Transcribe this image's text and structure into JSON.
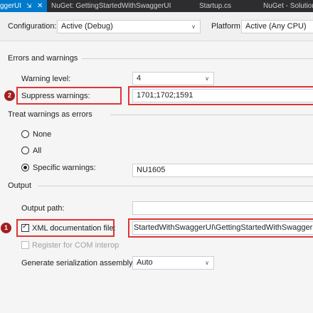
{
  "tabs": [
    {
      "label": "ggerUI",
      "active": true
    },
    {
      "label": "NuGet: GettingStartedWithSwaggerUI",
      "active": false
    },
    {
      "label": "Startup.cs",
      "active": false
    },
    {
      "label": "NuGet - Solution",
      "active": false
    }
  ],
  "tab_icons": {
    "pin": "pin-icon",
    "close": "close-icon"
  },
  "config_bar": {
    "configuration_label": "Configuration:",
    "configuration_value": "Active (Debug)",
    "platform_label": "Platform:",
    "platform_value": "Active (Any CPU)"
  },
  "errors_section": {
    "title": "Errors and warnings",
    "warning_level_label": "Warning level:",
    "warning_level_value": "4",
    "suppress_label": "Suppress warnings:",
    "suppress_value": "1701;1702;1591"
  },
  "treat_warnings": {
    "title": "Treat warnings as errors",
    "none_label": "None",
    "all_label": "All",
    "specific_label": "Specific warnings:",
    "specific_value": "NU1605",
    "selected": "specific"
  },
  "output": {
    "title": "Output",
    "output_path_label": "Output path:",
    "output_path_value": "",
    "xml_doc_label": "XML documentation file:",
    "xml_doc_checked": true,
    "xml_doc_value": "StartedWithSwaggerUI\\GettingStartedWithSwaggerUI.xml",
    "com_interop_label": "Register for COM interop",
    "serialization_label": "Generate serialization assembly:",
    "serialization_value": "Auto"
  },
  "markers": [
    "2",
    "1"
  ],
  "colors": {
    "accent": "#007acc",
    "highlight_box": "#e03535",
    "marker": "#a11e1e",
    "tab_bg": "#2d2d30"
  }
}
